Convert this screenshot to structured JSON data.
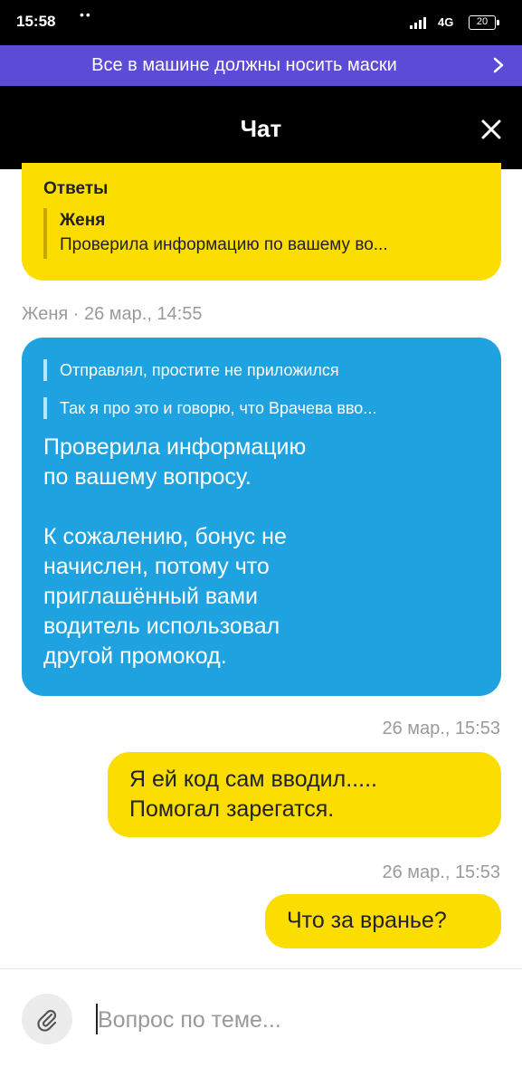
{
  "status_bar": {
    "time": "15:58",
    "dots": "••",
    "network": "4G",
    "battery": "20"
  },
  "banner": {
    "text": "Все в машине должны носить маски",
    "icon": "chevron-right-icon"
  },
  "header": {
    "title": "Чат",
    "close_icon": "close-icon"
  },
  "replies_block": {
    "label": "Ответы",
    "author": "Женя",
    "snippet": "Проверила информацию по вашему во..."
  },
  "incoming_message": {
    "meta": "Женя · 26 мар., 14:55",
    "quotes": [
      "Отправлял, простите не приложился",
      "Так я про это и говорю, что Врачева вво..."
    ],
    "text": "Проверила информацию\nпо вашему вопросу.\n\nК сожалению, бонус не\nначислен, потому что\nприглашённый вами\nводитель использовал\nдругой промокод."
  },
  "outgoing_messages": [
    {
      "meta": "26 мар., 15:53",
      "text": "Я ей код сам вводил.....\nПомогал зарегатся."
    },
    {
      "meta": "26 мар., 15:53",
      "text": "Что за вранье?"
    }
  ],
  "input_bar": {
    "placeholder": "Вопрос по теме...",
    "attach_icon": "paperclip-icon"
  },
  "colors": {
    "accent_yellow": "#fbde00",
    "incoming_blue": "#1fa2e0",
    "banner_purple": "#5b4bd6"
  }
}
